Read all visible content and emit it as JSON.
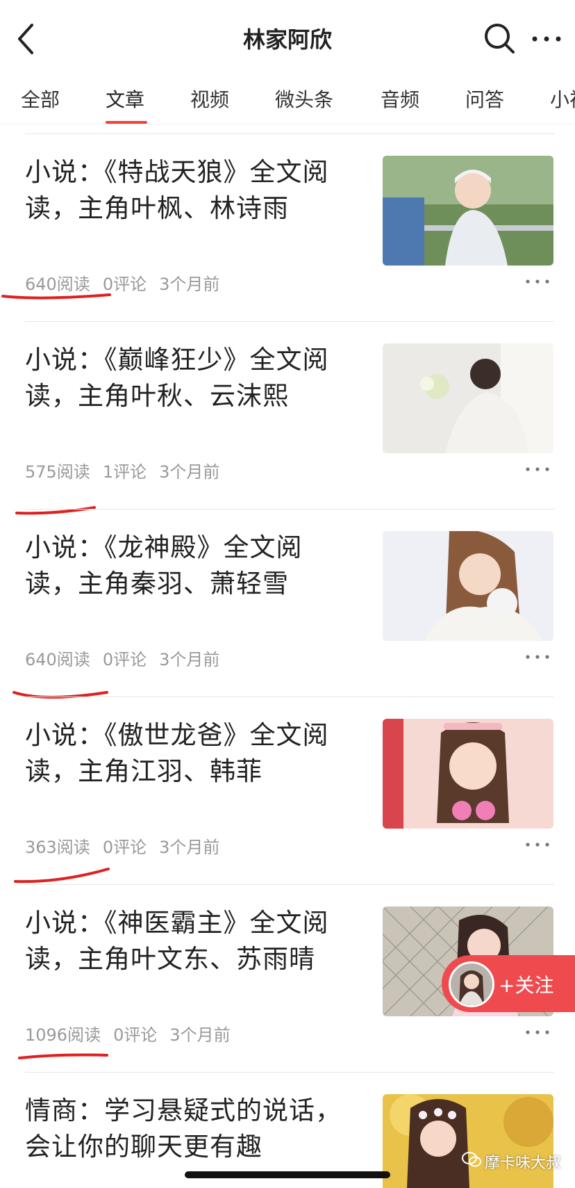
{
  "header": {
    "title": "林家阿欣"
  },
  "tabs": [
    {
      "label": "全部"
    },
    {
      "label": "文章"
    },
    {
      "label": "视频"
    },
    {
      "label": "微头条"
    },
    {
      "label": "音频"
    },
    {
      "label": "问答"
    },
    {
      "label": "小视"
    }
  ],
  "active_tab": "文章",
  "articles": [
    {
      "title": "小说：《特战天狼》全文阅读，主角叶枫、林诗雨",
      "reads": "640阅读",
      "comments": "0评论",
      "time": "3个月前"
    },
    {
      "title": "小说：《巅峰狂少》全文阅读，主角叶秋、云沫熙",
      "reads": "575阅读",
      "comments": "1评论",
      "time": "3个月前"
    },
    {
      "title": "小说：《龙神殿》全文阅读，主角秦羽、萧轻雪",
      "reads": "640阅读",
      "comments": "0评论",
      "time": "3个月前"
    },
    {
      "title": "小说：《傲世龙爸》全文阅读，主角江羽、韩菲",
      "reads": "363阅读",
      "comments": "0评论",
      "time": "3个月前"
    },
    {
      "title": "小说：《神医霸主》全文阅读，主角叶文东、苏雨晴",
      "reads": "1096阅读",
      "comments": "0评论",
      "time": "3个月前"
    },
    {
      "title": "情商：学习悬疑式的说话，会让你的聊天更有趣",
      "reads": "",
      "comments": "",
      "time": ""
    }
  ],
  "follow_button": {
    "label": "+关注"
  },
  "watermark": "摩卡味大叔",
  "colors": {
    "accent": "#f04142",
    "follow_bg": "#ef4a4d",
    "meta_text": "#999999",
    "annotation": "#e02020"
  }
}
